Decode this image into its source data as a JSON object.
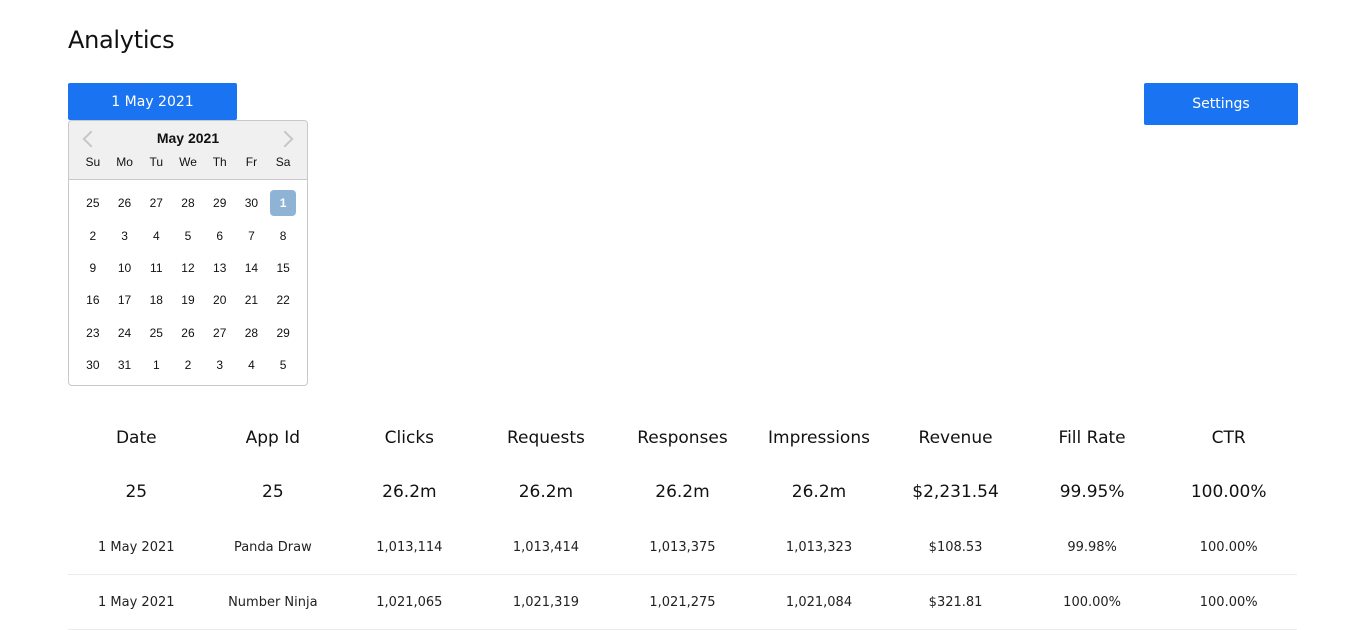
{
  "page": {
    "title": "Analytics"
  },
  "date_button": {
    "label": "1 May 2021"
  },
  "settings_button": {
    "label": "Settings"
  },
  "calendar": {
    "month_label": "May 2021",
    "weekdays": [
      "Su",
      "Mo",
      "Tu",
      "We",
      "Th",
      "Fr",
      "Sa"
    ],
    "days": [
      "25",
      "26",
      "27",
      "28",
      "29",
      "30",
      "1",
      "2",
      "3",
      "4",
      "5",
      "6",
      "7",
      "8",
      "9",
      "10",
      "11",
      "12",
      "13",
      "14",
      "15",
      "16",
      "17",
      "18",
      "19",
      "20",
      "21",
      "22",
      "23",
      "24",
      "25",
      "26",
      "27",
      "28",
      "29",
      "30",
      "31",
      "1",
      "2",
      "3",
      "4",
      "5"
    ],
    "selected_index": 6
  },
  "table": {
    "headers": [
      "Date",
      "App Id",
      "Clicks",
      "Requests",
      "Responses",
      "Impressions",
      "Revenue",
      "Fill Rate",
      "CTR"
    ],
    "totals": [
      "25",
      "25",
      "26.2m",
      "26.2m",
      "26.2m",
      "26.2m",
      "$2,231.54",
      "99.95%",
      "100.00%"
    ],
    "rows": [
      [
        "1 May 2021",
        "Panda Draw",
        "1,013,114",
        "1,013,414",
        "1,013,375",
        "1,013,323",
        "$108.53",
        "99.98%",
        "100.00%"
      ],
      [
        "1 May 2021",
        "Number Ninja",
        "1,021,065",
        "1,021,319",
        "1,021,275",
        "1,021,084",
        "$321.81",
        "100.00%",
        "100.00%"
      ]
    ]
  },
  "colors": {
    "accent": "#1a73f0",
    "selected_day": "#8fb3d4"
  }
}
